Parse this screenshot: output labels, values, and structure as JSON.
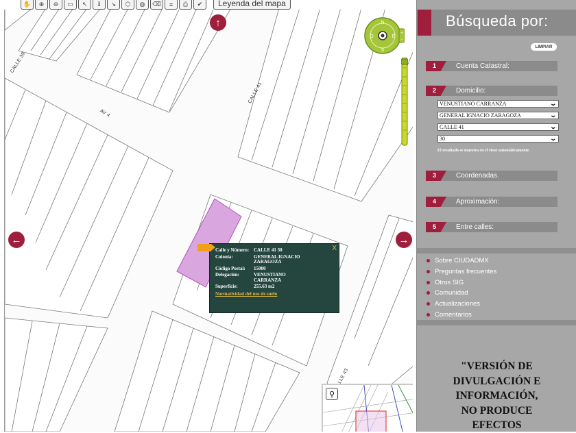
{
  "toolbar": {
    "tools": [
      "pan-tool",
      "zoom-in-tool",
      "zoom-out-tool",
      "full-extent-tool",
      "identify-tool",
      "info-tool",
      "measure-tool",
      "polygon-tool",
      "select-tool",
      "clear-tool",
      "layers-tool",
      "print-tool",
      "help-tool"
    ],
    "legend_label": "Leyenda del mapa"
  },
  "map": {
    "streets": {
      "calle39": "CALLE 39",
      "av4": "AV 4",
      "calle41": "CALLE 41",
      "calle43": "CALLE 43"
    },
    "popup": {
      "rows": [
        {
          "key": "Calle y Número:",
          "value": "CALLE 41 30"
        },
        {
          "key": "Colonia:",
          "value": "GENERAL IGNACIO ZARAGOZA"
        },
        {
          "key": "Código Postal:",
          "value": "15000"
        },
        {
          "key": "Delegación:",
          "value": "VENUSTIANO CARRANZA"
        },
        {
          "key": "Superficie:",
          "value": "255.63 m2"
        }
      ],
      "link": "Normatividad del uso de suelo",
      "close": "X"
    },
    "compass": {
      "n": "N",
      "s": "S",
      "e": "E",
      "o": "O"
    },
    "colors": {
      "accent": "#9e1e3c",
      "parcel": "#d9a6e0",
      "popup_bg": "#25463e"
    }
  },
  "panel": {
    "title": "Búsqueda por:",
    "clear_label": "LIMPIAR",
    "sections": [
      {
        "num": "1",
        "label": "Cuenta Catastral:"
      },
      {
        "num": "2",
        "label": "Domicilio:"
      },
      {
        "num": "3",
        "label": "Coordenadas."
      },
      {
        "num": "4",
        "label": "Aproximación:"
      },
      {
        "num": "5",
        "label": "Entre calles:"
      }
    ],
    "selects": [
      "VENUSTIANO CARRANZA",
      "GENERAL IGNACIO ZARAGOZA",
      "CALLE 41",
      "30"
    ],
    "note": "El resultado se muestra en el visor automáticamente.",
    "links": [
      "Sobre CIUDADMX",
      "Preguntas frecuentes",
      "Otros SIG",
      "Comunidad",
      "Actualizaciones",
      "Comentarios"
    ],
    "disclaimer": [
      "\"VERSIÓN DE",
      "DIVULGACIÓN E",
      "INFORMACIÓN,",
      "NO PRODUCE",
      "EFECTOS"
    ]
  }
}
